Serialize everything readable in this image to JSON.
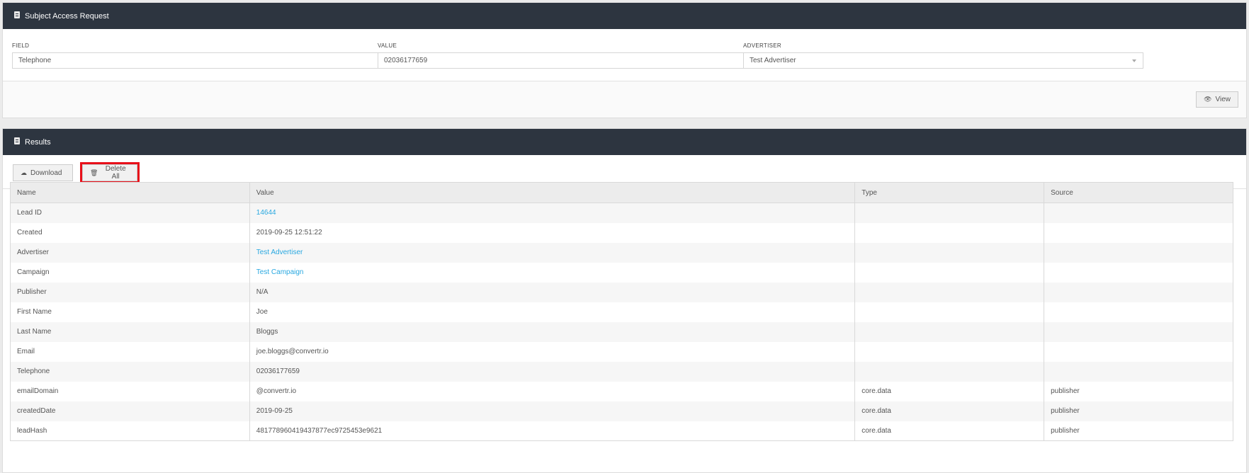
{
  "sar": {
    "title": "Subject Access Request",
    "header_icon": "document-icon",
    "field": {
      "label": "FIELD",
      "value": "Telephone"
    },
    "value": {
      "label": "VALUE",
      "value": "02036177659"
    },
    "advertiser": {
      "label": "ADVERTISER",
      "value": "Test Advertiser"
    },
    "view_button": {
      "label": "View",
      "icon": "eye-icon"
    }
  },
  "results": {
    "title": "Results",
    "header_icon": "document-icon",
    "download_button": {
      "label": "Download",
      "icon": "cloud-download-icon"
    },
    "delete_button": {
      "label": "Delete All",
      "icon": "trash-icon"
    },
    "highlight_color": "#e8101a",
    "link_color": "#29a8e0",
    "columns": [
      "Name",
      "Value",
      "Type",
      "Source"
    ],
    "rows": [
      {
        "name": "Lead ID",
        "value": "14644",
        "type": "",
        "source": "",
        "link": true
      },
      {
        "name": "Created",
        "value": "2019-09-25 12:51:22",
        "type": "",
        "source": "",
        "link": false
      },
      {
        "name": "Advertiser",
        "value": "Test Advertiser",
        "type": "",
        "source": "",
        "link": true
      },
      {
        "name": "Campaign",
        "value": "Test Campaign",
        "type": "",
        "source": "",
        "link": true
      },
      {
        "name": "Publisher",
        "value": "N/A",
        "type": "",
        "source": "",
        "link": false
      },
      {
        "name": "First Name",
        "value": "Joe",
        "type": "",
        "source": "",
        "link": false
      },
      {
        "name": "Last Name",
        "value": "Bloggs",
        "type": "",
        "source": "",
        "link": false
      },
      {
        "name": "Email",
        "value": "joe.bloggs@convertr.io",
        "type": "",
        "source": "",
        "link": false
      },
      {
        "name": "Telephone",
        "value": "02036177659",
        "type": "",
        "source": "",
        "link": false
      },
      {
        "name": "emailDomain",
        "value": "@convertr.io",
        "type": "core.data",
        "source": "publisher",
        "link": false
      },
      {
        "name": "createdDate",
        "value": "2019-09-25",
        "type": "core.data",
        "source": "publisher",
        "link": false
      },
      {
        "name": "leadHash",
        "value": "481778960419437877ec9725453e9621",
        "type": "core.data",
        "source": "publisher",
        "link": false
      }
    ]
  }
}
